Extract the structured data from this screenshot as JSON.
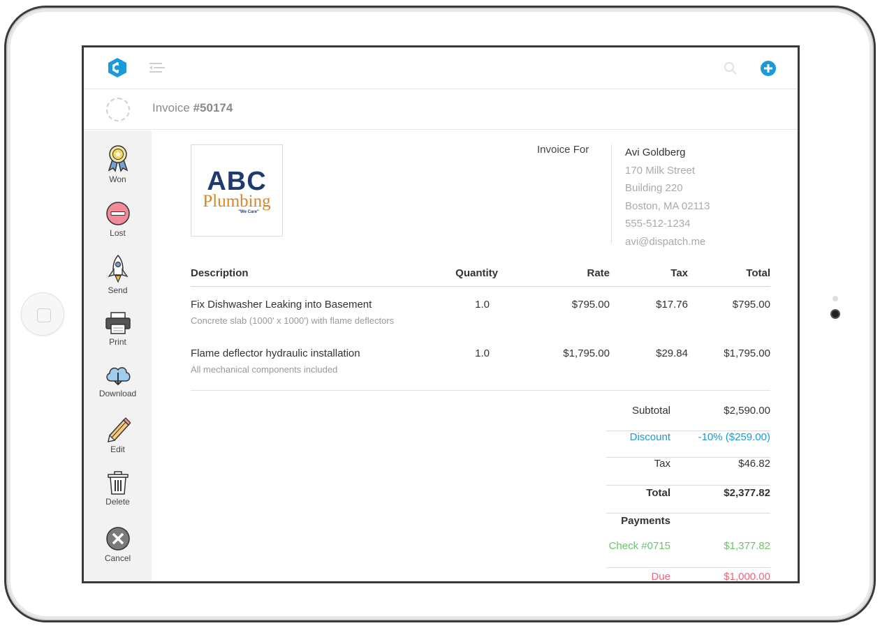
{
  "app": {
    "accent": "#1a9ad6"
  },
  "header": {
    "title_prefix": "Invoice ",
    "title_number": "#50174"
  },
  "actions": [
    {
      "label": "Won",
      "icon": "award-ribbon-icon"
    },
    {
      "label": "Lost",
      "icon": "minus-circle-icon"
    },
    {
      "label": "Send",
      "icon": "rocket-icon"
    },
    {
      "label": "Print",
      "icon": "printer-icon"
    },
    {
      "label": "Download",
      "icon": "cloud-download-icon"
    },
    {
      "label": "Edit",
      "icon": "pencil-icon"
    },
    {
      "label": "Delete",
      "icon": "trash-icon"
    },
    {
      "label": "Cancel",
      "icon": "close-circle-icon"
    }
  ],
  "company": {
    "logo_line1": "ABC",
    "logo_line2": "Plumbing",
    "logo_tagline": "\"We Care\""
  },
  "invoice_for": {
    "label": "Invoice For",
    "name": "Avi Goldberg",
    "street": "170 Milk Street",
    "building": "Building 220",
    "city": "Boston, MA 02113",
    "phone": "555-512-1234",
    "email": "avi@dispatch.me"
  },
  "table": {
    "headers": {
      "description": "Description",
      "quantity": "Quantity",
      "rate": "Rate",
      "tax": "Tax",
      "total": "Total"
    },
    "items": [
      {
        "description": "Fix Dishwasher Leaking into Basement",
        "note": "Concrete slab (1000' x 1000') with flame deflectors",
        "quantity": "1.0",
        "rate": "$795.00",
        "tax": "$17.76",
        "total": "$795.00"
      },
      {
        "description": "Flame deflector hydraulic installation",
        "note": "All mechanical components included",
        "quantity": "1.0",
        "rate": "$1,795.00",
        "tax": "$29.84",
        "total": "$1,795.00"
      }
    ]
  },
  "summary": {
    "subtotal_label": "Subtotal",
    "subtotal": "$2,590.00",
    "discount_label": "Discount",
    "discount": "-10% ($259.00)",
    "tax_label": "Tax",
    "tax": "$46.82",
    "total_label": "Total",
    "total": "$2,377.82",
    "payments_label": "Payments",
    "payment_label": "Check #0715",
    "payment": "$1,377.82",
    "due_label": "Due",
    "due": "$1,000.00"
  },
  "colors": {
    "discount": "#1a9ad6",
    "payment": "#6cc36c",
    "due": "#f0657a"
  }
}
